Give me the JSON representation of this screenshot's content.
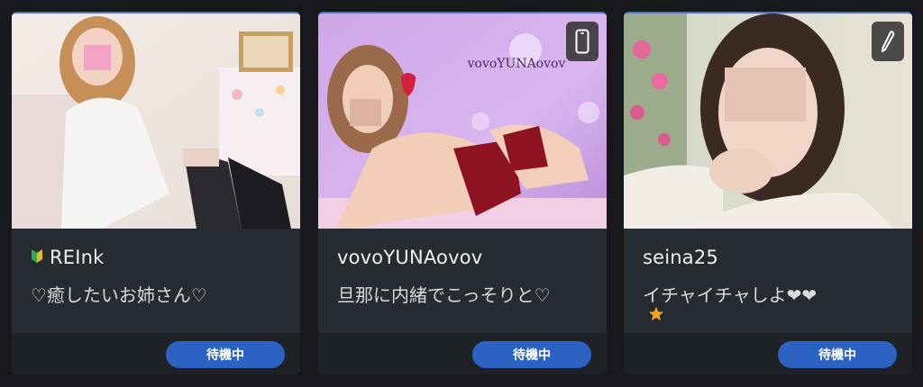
{
  "cards": [
    {
      "name": "REInk",
      "message": "♡癒したいお姉さん♡",
      "status": "待機中",
      "badge_icon": "beginner-leaf-icon",
      "device_icon": null,
      "rating_icon": null
    },
    {
      "name": "vovoYUNAovov",
      "message": "旦那に内緒でこっそりと♡",
      "status": "待機中",
      "photo_caption": "vovoYUNAovov",
      "device_icon": "smartphone-icon",
      "rating_icon": null
    },
    {
      "name": "seina25",
      "message": "イチャイチャしよ❤❤",
      "status": "待機中",
      "device_icon": "pen-icon",
      "rating_icon": "star-icon"
    }
  ],
  "colors": {
    "card_bg": "#262b31",
    "footer_bg": "#1e2226",
    "status_button": "#2c63c3",
    "card_top_border": "#4f73c9",
    "star": "#f2a51f"
  }
}
